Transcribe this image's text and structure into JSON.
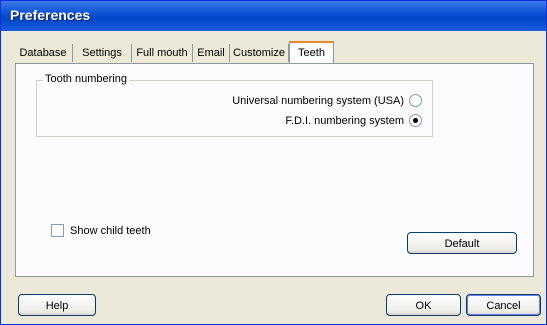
{
  "window": {
    "title": "Preferences"
  },
  "tabs": [
    {
      "label": "Database"
    },
    {
      "label": "Settings"
    },
    {
      "label": "Full mouth"
    },
    {
      "label": "Email"
    },
    {
      "label": "Customize"
    },
    {
      "label": "Teeth",
      "active": true
    }
  ],
  "tooth_numbering": {
    "group_label": "Tooth numbering",
    "options": [
      {
        "label": "Universal numbering system (USA)",
        "selected": false
      },
      {
        "label": "F.D.I. numbering system",
        "selected": true
      }
    ]
  },
  "show_child_teeth": {
    "label": "Show child teeth",
    "checked": false
  },
  "buttons": {
    "default": "Default",
    "help": "Help",
    "ok": "OK",
    "cancel": "Cancel"
  }
}
